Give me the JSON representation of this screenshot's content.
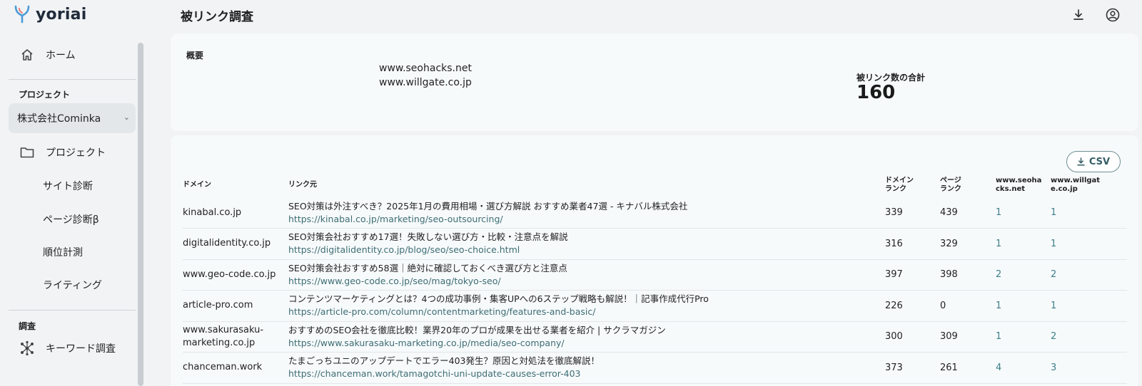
{
  "app": {
    "name": "yoriai"
  },
  "sidebar": {
    "home": "ホーム",
    "project_section": "プロジェクト",
    "project_selected": "株式会社Cominka",
    "items": [
      {
        "label": "プロジェクト"
      },
      {
        "label": "サイト診断"
      },
      {
        "label": "ページ診断β"
      },
      {
        "label": "順位計測"
      },
      {
        "label": "ライティング"
      }
    ],
    "research_section": "調査",
    "keyword_research": "キーワード調査"
  },
  "header": {
    "title": "被リンク調査",
    "download_icon": "download-icon",
    "account_icon": "account-circle-icon"
  },
  "summary": {
    "label": "概要",
    "sites": [
      "www.seohacks.net",
      "www.willgate.co.jp"
    ],
    "total_label": "被リンク数の合計",
    "total_value": "160"
  },
  "results": {
    "csv_label": "CSV",
    "columns": {
      "domain": "ドメイン",
      "source": "リンク元",
      "domain_rank_l1": "ドメイン",
      "domain_rank_l2": "ランク",
      "page_rank_l1": "ページ",
      "page_rank_l2": "ランク",
      "site1_l1": "www.seoha",
      "site1_l2": "cks.net",
      "site2_l1": "www.willgat",
      "site2_l2": "e.co.jp"
    },
    "rows": [
      {
        "domain": "kinabal.co.jp",
        "title": "SEO対策は外注すべき？2025年1月の費用相場・選び方解説 おすすめ業者47選 - キナバル株式会社",
        "url": "https://kinabal.co.jp/marketing/seo-outsourcing/",
        "domain_rank": "339",
        "page_rank": "439",
        "site1": "1",
        "site2": "1"
      },
      {
        "domain": "digitalidentity.co.jp",
        "title": "SEO対策会社おすすめ17選！失敗しない選び方・比較・注意点を解説",
        "url": "https://digitalidentity.co.jp/blog/seo/seo-choice.html",
        "domain_rank": "316",
        "page_rank": "329",
        "site1": "1",
        "site2": "1"
      },
      {
        "domain": "www.geo-code.co.jp",
        "title": "SEO対策会社おすすめ58選｜絶対に確認しておくべき選び方と注意点",
        "url": "https://www.geo-code.co.jp/seo/mag/tokyo-seo/",
        "domain_rank": "397",
        "page_rank": "398",
        "site1": "2",
        "site2": "2"
      },
      {
        "domain": "article-pro.com",
        "title": "コンテンツマーケティングとは？4つの成功事例・集客UPへの6ステップ戦略も解説！｜記事作成代行Pro",
        "url": "https://article-pro.com/column/contentmarketing/features-and-basic/",
        "domain_rank": "226",
        "page_rank": "0",
        "site1": "1",
        "site2": "1"
      },
      {
        "domain": "www.sakurasaku-marketing.co.jp",
        "domain_l1": "www.sakurasaku-",
        "domain_l2": "marketing.co.jp",
        "title": "おすすめのSEO会社を徹底比較！業界20年のプロが成果を出せる業者を紹介 | サクラマガジン",
        "url": "https://www.sakurasaku-marketing.co.jp/media/seo-company/",
        "domain_rank": "300",
        "page_rank": "309",
        "site1": "1",
        "site2": "2"
      },
      {
        "domain": "chanceman.work",
        "title": "たまごっちユニのアップデートでエラー403発生？原因と対処法を徹底解説！",
        "url": "https://chanceman.work/tamagotchi-uni-update-causes-error-403",
        "domain_rank": "373",
        "page_rank": "261",
        "site1": "4",
        "site2": "3"
      }
    ]
  }
}
